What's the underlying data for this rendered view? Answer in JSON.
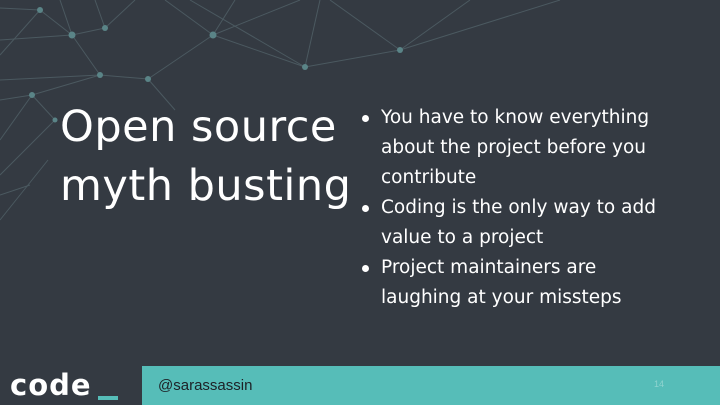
{
  "slide": {
    "title_line1": "Open source",
    "title_line2": "myth busting",
    "bullets": [
      {
        "lines": [
          "You have to know everything",
          "about the project before you",
          "contribute"
        ]
      },
      {
        "lines": [
          "Coding is the only way to add",
          "value to a project"
        ]
      },
      {
        "lines": [
          "Project maintainers are",
          "laughing at your missteps"
        ]
      }
    ]
  },
  "footer": {
    "logo": "code",
    "handle": "@sarassassin",
    "page_number": "14"
  },
  "colors": {
    "background": "#343a42",
    "accent_teal": "#56bdb8",
    "text_white": "#ffffff",
    "network_lines": "#4a5a60",
    "network_nodes": "#5f8a8c"
  }
}
